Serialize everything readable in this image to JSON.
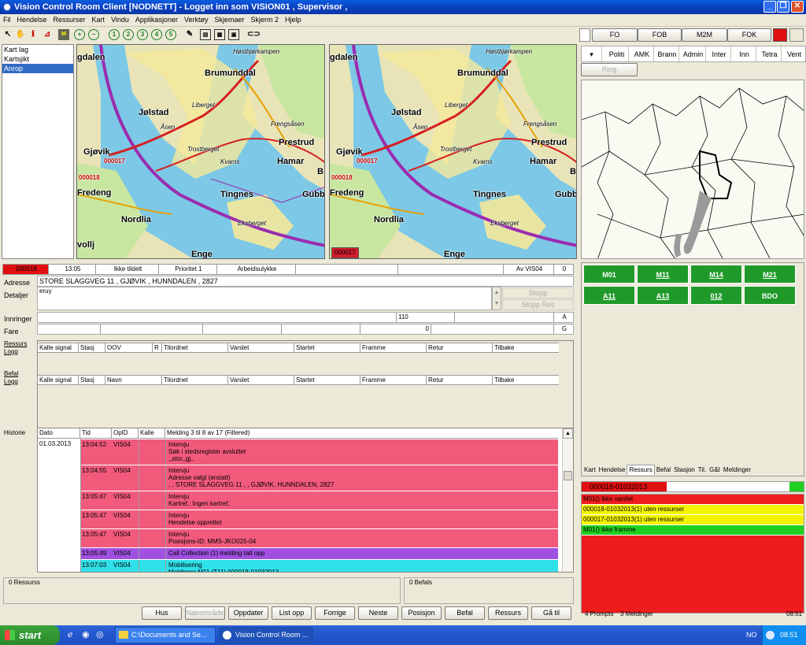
{
  "window": {
    "title": "Vision Control Room Client [NODNETT] - Logget inn som VISION01 , Supervisor ,"
  },
  "menu": [
    "Fil",
    "Hendelse",
    "Ressurser",
    "Kart",
    "Vindu",
    "Applikasjoner",
    "Verktøy",
    "Skjemaer",
    "Skjerm 2",
    "Hjelp"
  ],
  "layers": {
    "items": [
      "Kart lag",
      "Kartsjikt",
      "Anrop"
    ],
    "selected": "Anrop"
  },
  "maps": {
    "labels": [
      "Høstbjørkampen",
      "Brumunddal",
      "Jølstad",
      "Åsen",
      "Liberget",
      "Frengsåsen",
      "Prestrud",
      "Hamar",
      "Gjøvik",
      "Trostberget",
      "Kvams",
      "Fredeng",
      "Tingnes",
      "Gubb",
      "Nordlia",
      "Eksberget",
      "Enge",
      "gdalen",
      "vollj",
      "B"
    ],
    "markers": [
      "000017",
      "000018"
    ],
    "selected_marker": "000017"
  },
  "categories": {
    "top": [
      "FO",
      "FOB",
      "M2M",
      "FOK"
    ],
    "top_color": "#e01010",
    "bottom": [
      "Politi",
      "AMK",
      "Brann",
      "Admin",
      "Inter",
      "Inn",
      "Tetra",
      "Vent"
    ],
    "ring_label": "Ring"
  },
  "incident": {
    "id": "000018",
    "time": "13:05",
    "assign": "Ikke tildelt",
    "priority": "Prioritet 1",
    "type": "Arbeidsulykke",
    "operator": "Av VIS04",
    "count": "0",
    "address_label": "Adresse",
    "address": "STORE SLAGGVEG 11 , GJØVIK , HUNNDALEN , 2827",
    "details_label": "Detaljer",
    "details": "eruy",
    "stopp": "Stopp",
    "stopp_res": "Stopp Res",
    "innringer_label": "Innringer",
    "innringer_val": "110",
    "innringer_code": "A",
    "fare_label": "Fare",
    "fare_val": "0",
    "fare_code": "G"
  },
  "resources_table": {
    "label1": "Ressurs",
    "label2": "Logg",
    "headers": [
      "Kalle signal",
      "Stasj",
      "OOV",
      "R",
      "Tilordnet",
      "Varslet",
      "Startet",
      "Framme",
      "Retur",
      "Tilbake"
    ]
  },
  "befal_table": {
    "label1": "Befal",
    "label2": "Logg",
    "headers": [
      "Kalle signal",
      "Stasj",
      "Navn",
      "Tilordnet",
      "Varslet",
      "Startet",
      "Framme",
      "Retur",
      "Tilbake"
    ]
  },
  "history": {
    "label": "Historie",
    "headers": [
      "Dato",
      "Tid",
      "OpID",
      "Kalle",
      "Melding 3 til 8 av 17  (Filtered)"
    ],
    "date": "01.03.2013",
    "rows": [
      {
        "time": "13:04:52",
        "op": "VIS04",
        "text": "Intervju\nSøk i stedsregister avsluttet\n,,stor,,gj,,",
        "color": "#f25a7c"
      },
      {
        "time": "13:04:55",
        "op": "VIS04",
        "text": "Intervju\nAdresse valgt (erstatt)\n, , STORE SLAGGVEG 11 , , GJØVIK, HUNNDALEN, 2827",
        "color": "#f25a7c"
      },
      {
        "time": "13:05:47",
        "op": "VIS04",
        "text": "Intervju\nKartref.: Ingen kartref.",
        "color": "#f25a7c"
      },
      {
        "time": "13:05:47",
        "op": "VIS04",
        "text": "Intervju\nHendelse opprettet",
        "color": "#f25a7c"
      },
      {
        "time": "13:05:47",
        "op": "VIS04",
        "text": "Intervju\nPosisjons-ID: MMS-JKO025-04",
        "color": "#f25a7c"
      },
      {
        "time": "13:05:49",
        "op": "VIS04",
        "text": "Call Collection (1) melding tatt opp",
        "color": "#a050e0"
      },
      {
        "time": "13:07:03",
        "op": "VIS04",
        "text": "Mobilisering\nMeldinger M11 (T11) 000018-01032013",
        "color": "#30e0e8"
      }
    ]
  },
  "bottom_panels": {
    "ressurs": "0 Ressurss",
    "befal": "0 Befals"
  },
  "bottom_buttons": [
    "Hus",
    "Nærområde",
    "Oppdater",
    "List opp",
    "Forrige",
    "Neste",
    "Posisjon",
    "Befal",
    "Ressurs",
    "Gå til"
  ],
  "resources": {
    "units": [
      {
        "label": "M01",
        "u": false
      },
      {
        "label": "M11",
        "u": true
      },
      {
        "label": "M14",
        "u": true
      },
      {
        "label": "M21",
        "u": true
      },
      {
        "label": "A11",
        "u": true
      },
      {
        "label": "A13",
        "u": true
      },
      {
        "label": "012",
        "u": true
      },
      {
        "label": "BDO",
        "u": false
      }
    ],
    "color": "#1f9a2a"
  },
  "right_tabs": [
    "Kart",
    "Hendelse",
    "Ressurs",
    "Befal",
    "Stasjon",
    "Til.",
    "G&I",
    "Meldinger"
  ],
  "alerts": {
    "title": "000018-01032013",
    "items": [
      {
        "text": "M01() ikke varslet",
        "color": "#ee1d1d"
      },
      {
        "text": "000018-01032013(1) uten ressurser",
        "color": "#f4f400"
      },
      {
        "text": "000017-01032013(1) uten ressurser",
        "color": "#f4f400"
      },
      {
        "text": "M01() ikke framme",
        "color": "#20d020"
      }
    ],
    "bg": "#ee1d1d"
  },
  "status": {
    "prompts": "4 Prompts",
    "meldinger": "3 Meldinger",
    "time": "08:51"
  },
  "taskbar": {
    "start": "start",
    "items": [
      "C:\\Documents and Se...",
      "Vision Control Room ..."
    ],
    "lang": "NO",
    "clock": "08:51"
  }
}
